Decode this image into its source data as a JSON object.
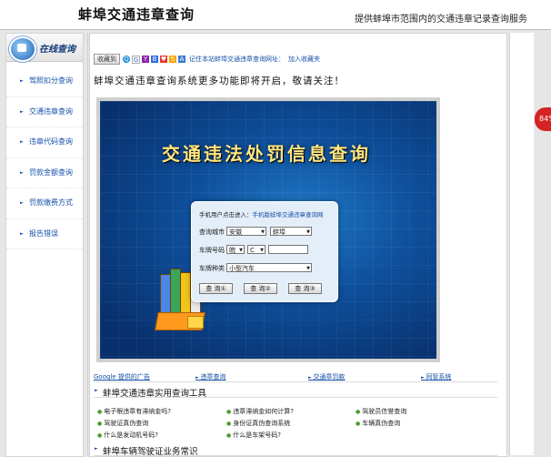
{
  "header": {
    "title": "蚌埠交通违章查询",
    "slogan": "提供蚌埠市范围内的交通违章记录查询服务"
  },
  "sidebar": {
    "heading": "在线查询",
    "items": [
      {
        "label": "驾照扣分查询"
      },
      {
        "label": "交通违章查询"
      },
      {
        "label": "违章代码查询"
      },
      {
        "label": "罚款金额查询"
      },
      {
        "label": "罚款缴费方式"
      },
      {
        "label": "报告错误"
      }
    ]
  },
  "badge": {
    "value": "84%"
  },
  "toolbar": {
    "favorite_label": "收藏到",
    "icons": [
      "qq-icon",
      "google-icon",
      "yahoo-icon",
      "baidu-icon",
      "heart-icon",
      "search-icon",
      "person-icon"
    ],
    "text": "记住本站蚌埠交通违章查询网址：",
    "add_favorite": "加入收藏夹"
  },
  "notice": "蚌埠交通违章查询系统更多功能即将开启，敬请关注！",
  "banner": {
    "title": "交通违法处罚信息查询",
    "mobile_prefix": "手机用户点击进入：",
    "mobile_link": "手机版蚌埠交通违章查询网",
    "city_label": "查询城市",
    "province": "安徽",
    "city": "蚌埠",
    "plate_label": "车牌号码",
    "plate_prefix": "皖",
    "plate_letter": "C",
    "plate_value": "",
    "type_label": "车牌种类",
    "vehicle_type": "小型汽车",
    "buttons": [
      "查 询①",
      "查 询②",
      "查 询③"
    ]
  },
  "ads": {
    "label": "Google 提供的广告",
    "links": [
      "违章查询",
      "交通章罚款",
      "同管系统"
    ]
  },
  "tools_section": {
    "title": "蚌埠交通违章实用查询工具",
    "items": [
      [
        "电子眼违章有滞纳金吗?",
        "违章滞纳金如何计算?",
        "驾驶员信誉查询"
      ],
      [
        "驾驶证真伪查询",
        "身份证真伪查询系统",
        "车辆真伪查询"
      ],
      [
        "什么是发动机号码?",
        "什么是车架号码?",
        ""
      ]
    ]
  },
  "knowledge_section": {
    "title": "蚌埠车辆驾驶证业务常识"
  },
  "colors": {
    "link": "#1650a8",
    "banner_bg": "#0e4f9b",
    "title_gold": "#ffe680",
    "badge": "#d42323"
  }
}
